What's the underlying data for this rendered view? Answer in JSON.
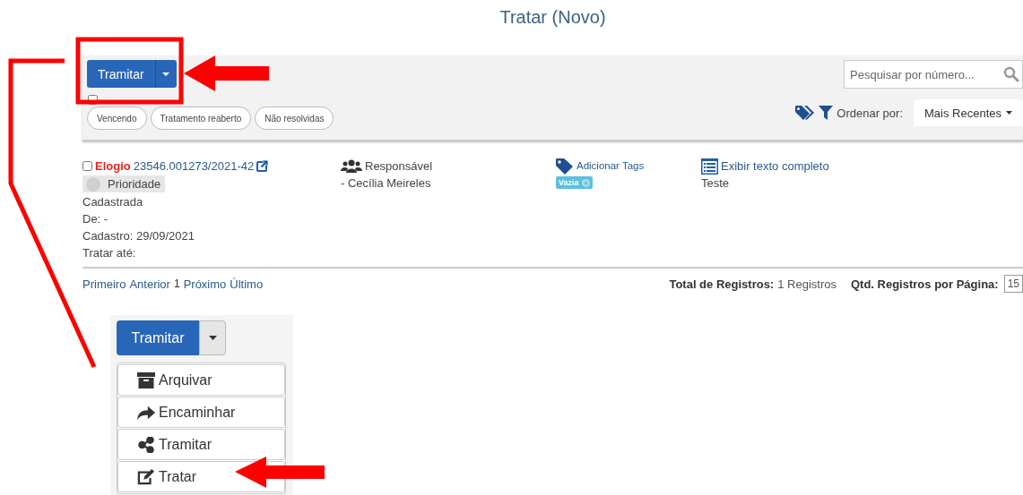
{
  "title": "Tratar (Novo)",
  "toolbar": {
    "primary_button": "Tramitar",
    "select_all": {
      "checked": false
    },
    "chips": [
      "Vencendo",
      "Tratamento reaberto",
      "Não resolvidas"
    ],
    "search": {
      "placeholder": "Pesquisar por número..."
    },
    "sort_label": "Ordenar por:",
    "sort_value": "Mais Recentes"
  },
  "record": {
    "checked": false,
    "type": "Elogio",
    "number": "23546.001273/2021-42",
    "priority": "Prioridade",
    "details": [
      "Cadastrada",
      "De: -",
      "Cadastro: 29/09/2021",
      "Tratar até:"
    ],
    "responsible_label": "Responsável",
    "responsible": "- Cecília Meireles",
    "add_tags": "Adicionar Tags",
    "tags": [
      {
        "label": "Vazia"
      }
    ],
    "full_text_link": "Exibir texto completo",
    "text": "Teste"
  },
  "pagination": {
    "links": [
      {
        "label": "Primeiro",
        "current": false
      },
      {
        "label": "Anterior",
        "current": false
      },
      {
        "label": "1",
        "current": true
      },
      {
        "label": "Próximo",
        "current": false
      },
      {
        "label": "Último",
        "current": false
      }
    ],
    "total_label": "Total de Registros:",
    "total_value": "1 Registros",
    "per_page_label": "Qtd. Registros por Página:",
    "per_page_value": "15"
  },
  "inset": {
    "button": "Tramitar",
    "menu": [
      {
        "label": "Arquivar",
        "kind": "archive"
      },
      {
        "label": "Encaminhar",
        "kind": "forward"
      },
      {
        "label": "Tramitar",
        "kind": "share"
      },
      {
        "label": "Tratar",
        "kind": "edit"
      }
    ]
  }
}
